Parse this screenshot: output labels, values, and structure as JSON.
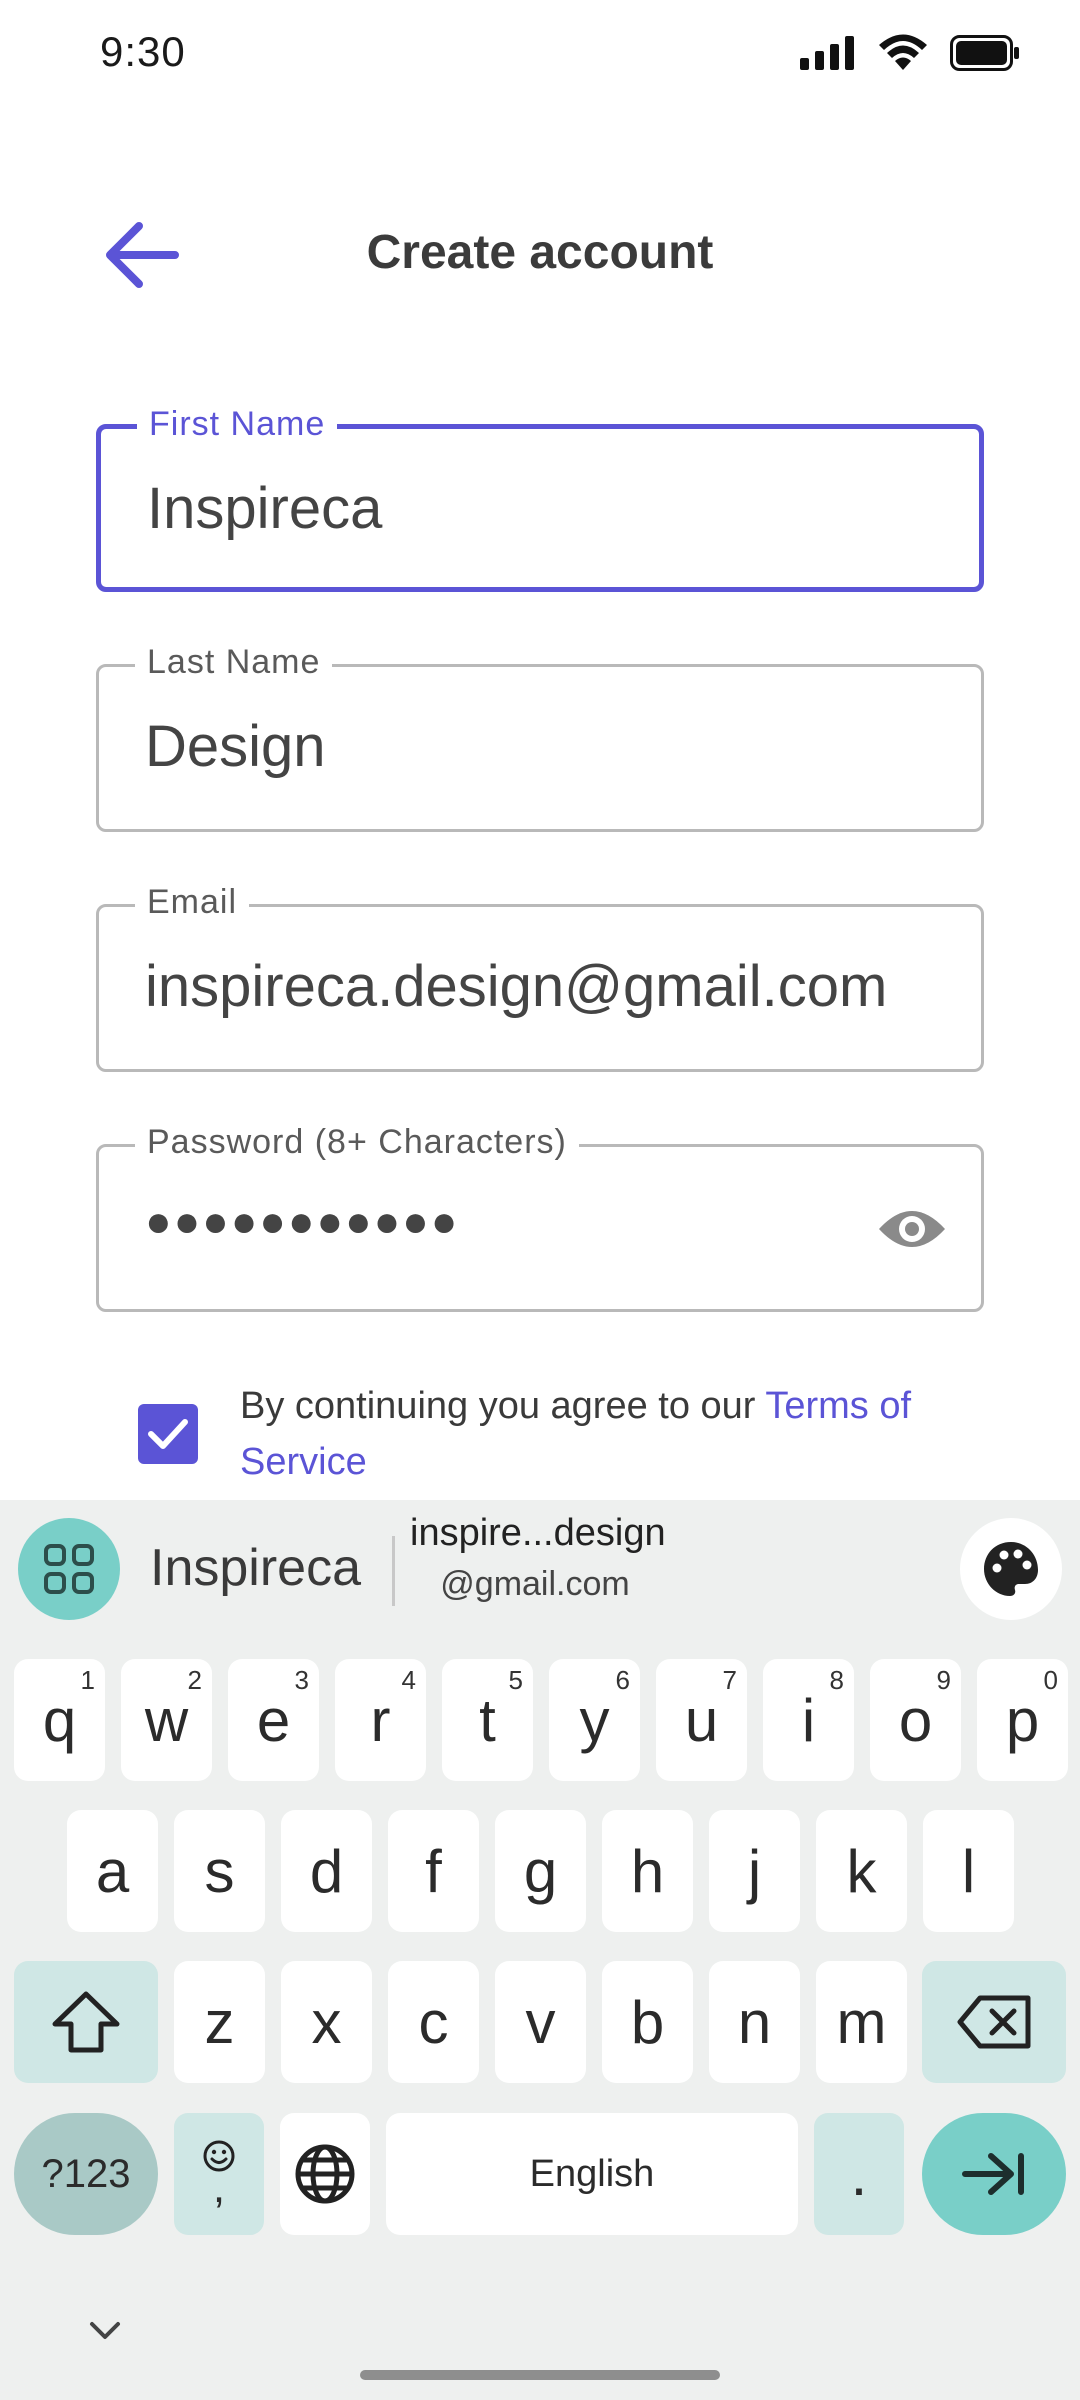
{
  "status_bar": {
    "time": "9:30"
  },
  "header": {
    "title": "Create account"
  },
  "form": {
    "first_name": {
      "label": "First Name",
      "value": "Inspireca"
    },
    "last_name": {
      "label": "Last Name",
      "value": "Design"
    },
    "email": {
      "label": "Email",
      "value": "inspireca.design@gmail.com"
    },
    "password": {
      "label": "Password (8+ Characters)",
      "masked_value": "●●●●●●●●●●●"
    }
  },
  "terms": {
    "prefix": "By continuing you agree to our ",
    "link": "Terms of Service",
    "checked": true
  },
  "keyboard": {
    "suggestions": {
      "first": "Inspireca",
      "second_line1": "inspire...design",
      "second_line2": "@gmail.com"
    },
    "row1": [
      {
        "k": "q",
        "h": "1"
      },
      {
        "k": "w",
        "h": "2"
      },
      {
        "k": "e",
        "h": "3"
      },
      {
        "k": "r",
        "h": "4"
      },
      {
        "k": "t",
        "h": "5"
      },
      {
        "k": "y",
        "h": "6"
      },
      {
        "k": "u",
        "h": "7"
      },
      {
        "k": "i",
        "h": "8"
      },
      {
        "k": "o",
        "h": "9"
      },
      {
        "k": "p",
        "h": "0"
      }
    ],
    "row2": [
      "a",
      "s",
      "d",
      "f",
      "g",
      "h",
      "j",
      "k",
      "l"
    ],
    "row3": [
      "z",
      "x",
      "c",
      "v",
      "b",
      "n",
      "m"
    ],
    "symbols_label": "?123",
    "emoji_label": ",",
    "space_label": "English",
    "period_label": "."
  },
  "colors": {
    "accent": "#5b54d6",
    "keyboard_accent": "#79cfc8"
  }
}
